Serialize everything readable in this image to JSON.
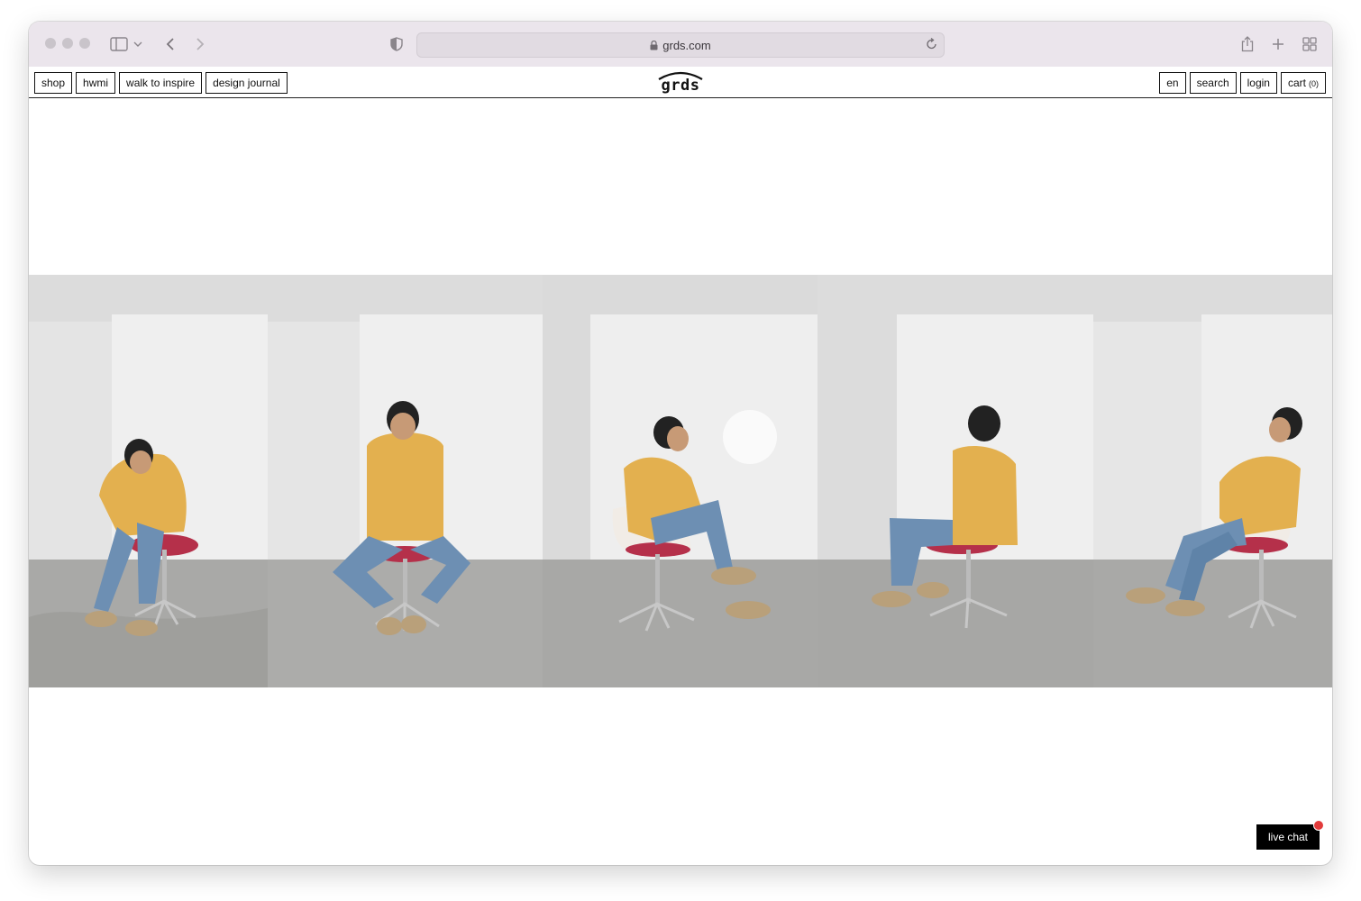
{
  "browser": {
    "url": "grds.com"
  },
  "nav": {
    "left": [
      {
        "label": "shop"
      },
      {
        "label": "hwmi"
      },
      {
        "label": "walk to inspire"
      },
      {
        "label": "design journal"
      }
    ],
    "logo": "grds",
    "right": {
      "lang": "en",
      "search": "search",
      "login": "login",
      "cart_label": "cart",
      "cart_count": "(0)"
    }
  },
  "photos": [
    {
      "pose": "leaning forward, tying shoe"
    },
    {
      "pose": "sitting facing camera"
    },
    {
      "pose": "side profile, hand to chin"
    },
    {
      "pose": "seated from behind"
    },
    {
      "pose": "side profile, reading hands"
    }
  ],
  "chat": {
    "label": "live chat"
  },
  "colors": {
    "chrome": "#ebe5ec",
    "sweater": "#e3b04f",
    "jeans": "#6d8fb3",
    "seat": "#b5304a",
    "chat_bg": "#000000",
    "notify": "#e23b3b"
  }
}
